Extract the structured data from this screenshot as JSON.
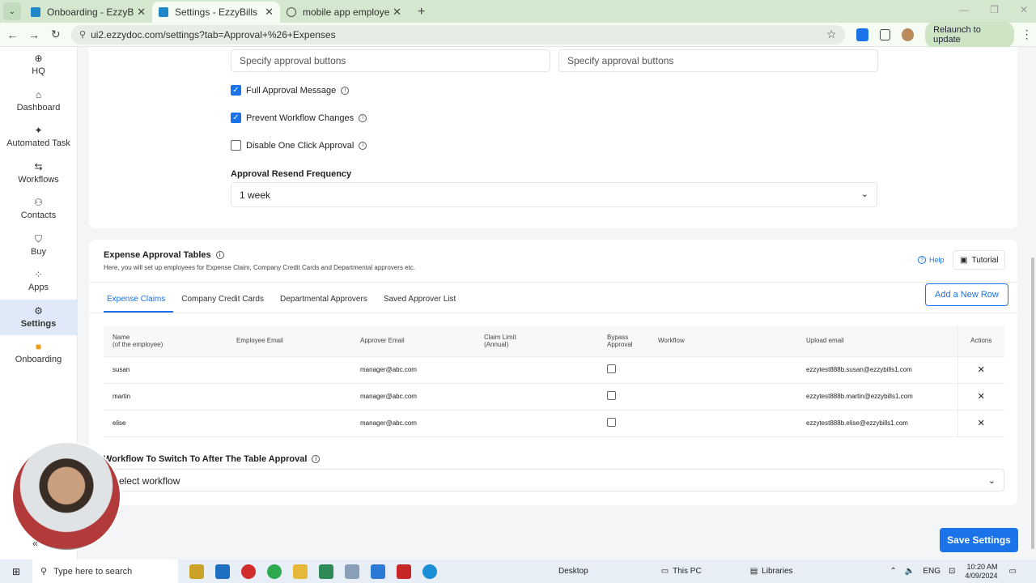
{
  "browser": {
    "tabs": [
      {
        "label": "Onboarding - EzzyBills"
      },
      {
        "label": "Settings - EzzyBills"
      },
      {
        "label": "mobile app employee name.pn"
      }
    ],
    "url": "ui2.ezzydoc.com/settings?tab=Approval+%26+Expenses",
    "relaunch_label": "Relaunch to update"
  },
  "sidebar": {
    "items": [
      {
        "label": "HQ",
        "icon": "globe-icon"
      },
      {
        "label": "Dashboard",
        "icon": "home-icon"
      },
      {
        "label": "Automated Task",
        "icon": "sparkle-icon"
      },
      {
        "label": "Workflows",
        "icon": "workflow-icon"
      },
      {
        "label": "Contacts",
        "icon": "contacts-icon"
      },
      {
        "label": "Buy",
        "icon": "cart-icon"
      },
      {
        "label": "Apps",
        "icon": "apps-icon"
      },
      {
        "label": "Settings",
        "icon": "gear-icon",
        "active": true
      },
      {
        "label": "Onboarding",
        "icon": "video-icon"
      }
    ]
  },
  "approval": {
    "spec_placeholder_1": "Specify approval buttons",
    "spec_placeholder_2": "Specify approval buttons",
    "options": [
      {
        "label": "Full Approval Message",
        "checked": true
      },
      {
        "label": "Prevent Workflow Changes",
        "checked": true
      },
      {
        "label": "Disable One Click Approval",
        "checked": false
      }
    ],
    "resend_label": "Approval Resend Frequency",
    "resend_value": "1 week"
  },
  "expense": {
    "title": "Expense Approval Tables",
    "description": "Here, you will set up employees for Expense Claim, Company Credit Cards and Departmental approvers etc.",
    "help_label": "Help",
    "tutorial_label": "Tutorial",
    "tabs": [
      "Expense Claims",
      "Company Credit Cards",
      "Departmental Approvers",
      "Saved Approver List"
    ],
    "add_row_label": "Add a New Row",
    "columns": {
      "name": "Name",
      "name_sub": "(of the employee)",
      "employee_email": "Employee Email",
      "approver_email": "Approver Email",
      "claim_limit": "Claim Limit",
      "claim_limit_sub": "(Annual)",
      "bypass": "Bypass",
      "bypass_sub": "Approval",
      "workflow": "Workflow",
      "upload_email": "Upload email",
      "actions": "Actions"
    },
    "rows": [
      {
        "name": "susan",
        "employee_email": "",
        "approver_email": "manager@abc.com",
        "claim_limit": "",
        "bypass": false,
        "workflow": "",
        "upload_email": "ezzytest888b.susan@ezzybills1.com"
      },
      {
        "name": "martin",
        "employee_email": "",
        "approver_email": "manager@abc.com",
        "claim_limit": "",
        "bypass": false,
        "workflow": "",
        "upload_email": "ezzytest888b.martin@ezzybills1.com"
      },
      {
        "name": "elise",
        "employee_email": "",
        "approver_email": "manager@abc.com",
        "claim_limit": "",
        "bypass": false,
        "workflow": "",
        "upload_email": "ezzytest888b.elise@ezzybills1.com"
      }
    ],
    "workflow_switch_label": "Workflow To Switch To After The Table Approval",
    "workflow_select_value": "Select workflow"
  },
  "save_label": "Save Settings",
  "taskbar": {
    "search_placeholder": "Type here to search",
    "desktop_label": "Desktop",
    "thispc_label": "This PC",
    "libraries_label": "Libraries",
    "lang": "ENG",
    "time": "10:20 AM",
    "date": "4/09/2024"
  },
  "colors": {
    "accent": "#1a73e8",
    "chrome": "#d4e7cf"
  }
}
